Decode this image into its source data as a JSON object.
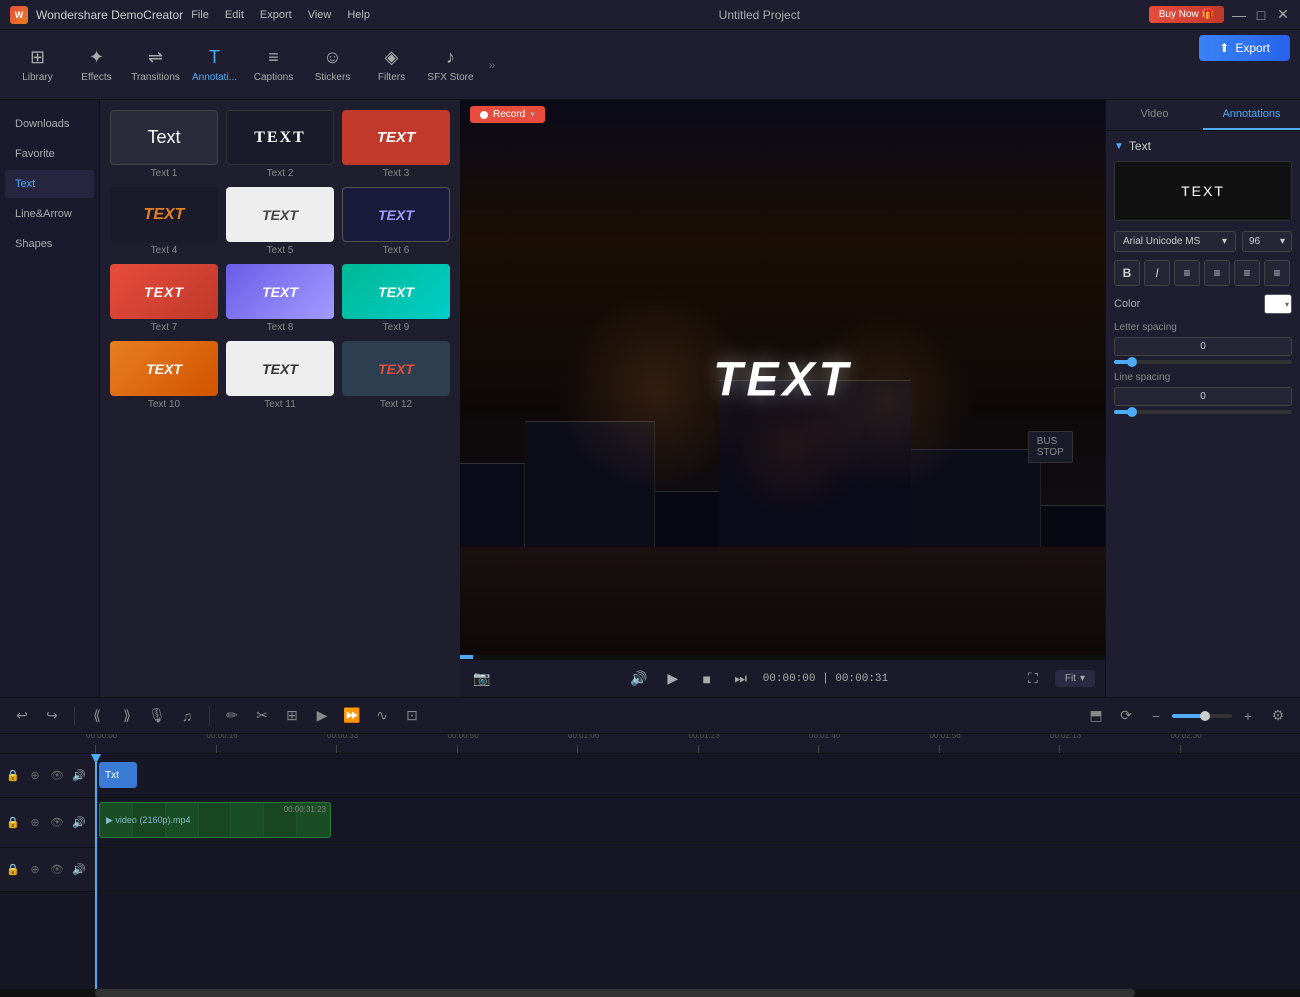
{
  "app": {
    "name": "Wondershare DemoCreator",
    "logo_text": "W",
    "project_title": "Untitled Project"
  },
  "menu": {
    "items": [
      "File",
      "Edit",
      "Export",
      "View",
      "Help"
    ]
  },
  "titlebar": {
    "buy_btn": "Buy Now",
    "win_btns": [
      "—",
      "□",
      "✕"
    ]
  },
  "toolbar": {
    "items": [
      {
        "id": "library",
        "label": "Library",
        "icon": "⊞"
      },
      {
        "id": "effects",
        "label": "Effects",
        "icon": "✦"
      },
      {
        "id": "transitions",
        "label": "Transitions",
        "icon": "⇌"
      },
      {
        "id": "annotations",
        "label": "Annotati...",
        "icon": "T",
        "active": true
      },
      {
        "id": "captions",
        "label": "Captions",
        "icon": "≡"
      },
      {
        "id": "stickers",
        "label": "Stickers",
        "icon": "☺"
      },
      {
        "id": "filters",
        "label": "Filters",
        "icon": "◈"
      },
      {
        "id": "sfxstore",
        "label": "SFX Store",
        "icon": "♪"
      }
    ],
    "more_icon": "»"
  },
  "sidebar": {
    "items": [
      {
        "id": "downloads",
        "label": "Downloads"
      },
      {
        "id": "favorite",
        "label": "Favorite"
      },
      {
        "id": "text",
        "label": "Text",
        "active": true
      },
      {
        "id": "linearrow",
        "label": "Line&Arrow"
      },
      {
        "id": "shapes",
        "label": "Shapes"
      }
    ]
  },
  "annotations": {
    "items": [
      {
        "id": 1,
        "label": "Text 1",
        "style": "ann1",
        "text": "Text"
      },
      {
        "id": 2,
        "label": "Text 2",
        "style": "ann2",
        "text": "TEXT"
      },
      {
        "id": 3,
        "label": "Text 3",
        "style": "ann3",
        "text": "TEXT"
      },
      {
        "id": 4,
        "label": "Text 4",
        "style": "ann4",
        "text": "TEXT"
      },
      {
        "id": 5,
        "label": "Text 5",
        "style": "ann5",
        "text": "TEXT"
      },
      {
        "id": 6,
        "label": "Text 6",
        "style": "ann6",
        "text": "TEXT"
      },
      {
        "id": 7,
        "label": "Text 7",
        "style": "ann7",
        "text": "TEXT"
      },
      {
        "id": 8,
        "label": "Text 8",
        "style": "ann8",
        "text": "TEXT"
      },
      {
        "id": 9,
        "label": "Text 9",
        "style": "ann9",
        "text": "TEXT"
      },
      {
        "id": 10,
        "label": "Text 10",
        "style": "ann10",
        "text": "TEXT"
      },
      {
        "id": 11,
        "label": "Text 11",
        "style": "ann11",
        "text": "TEXT"
      },
      {
        "id": 12,
        "label": "Text 12",
        "style": "ann12",
        "text": "TEXT"
      }
    ]
  },
  "preview": {
    "record_label": "Record",
    "overlay_text": "TEXT",
    "time_current": "00:00:00",
    "time_total": "00:00:31",
    "fit_label": "Fit",
    "screenshot_icon": "📷"
  },
  "props": {
    "tabs": [
      "Video",
      "Annotations"
    ],
    "active_tab": "Annotations",
    "section": "Text",
    "text_value": "TEXT",
    "font": "Arial Unicode MS",
    "size": "96",
    "bold": "B",
    "italic": "I",
    "align_left": "≡",
    "align_center": "≡",
    "align_right": "≡",
    "align_justify": "≡",
    "color_label": "Color",
    "letter_spacing_label": "Letter spacing",
    "letter_spacing_value": "0",
    "line_spacing_label": "Line spacing",
    "line_spacing_value": "0"
  },
  "timeline": {
    "toolbar_btns": [
      "↩",
      "↪",
      "⟪",
      "⟫",
      "🎙",
      "♫",
      "✏",
      "✂",
      "⊞",
      "▶",
      "▶▶"
    ],
    "ruler_marks": [
      "00:00:00",
      "00:00:16:20",
      "00:00:33:10",
      "00:00:50:00",
      "00:01:06:25",
      "00:01:23:10",
      "00:01:40:00",
      "00:01:56:20",
      "00:02:13:10",
      "00:02:30:00"
    ],
    "tracks": [
      {
        "id": "text-track",
        "type": "text",
        "clip_label": "Txt"
      },
      {
        "id": "video-track",
        "type": "video",
        "clip_label": "video (2160p).mp4",
        "clip_duration": "00:00:31:23"
      },
      {
        "id": "audio-track",
        "type": "audio"
      }
    ],
    "export_label": "Export"
  }
}
